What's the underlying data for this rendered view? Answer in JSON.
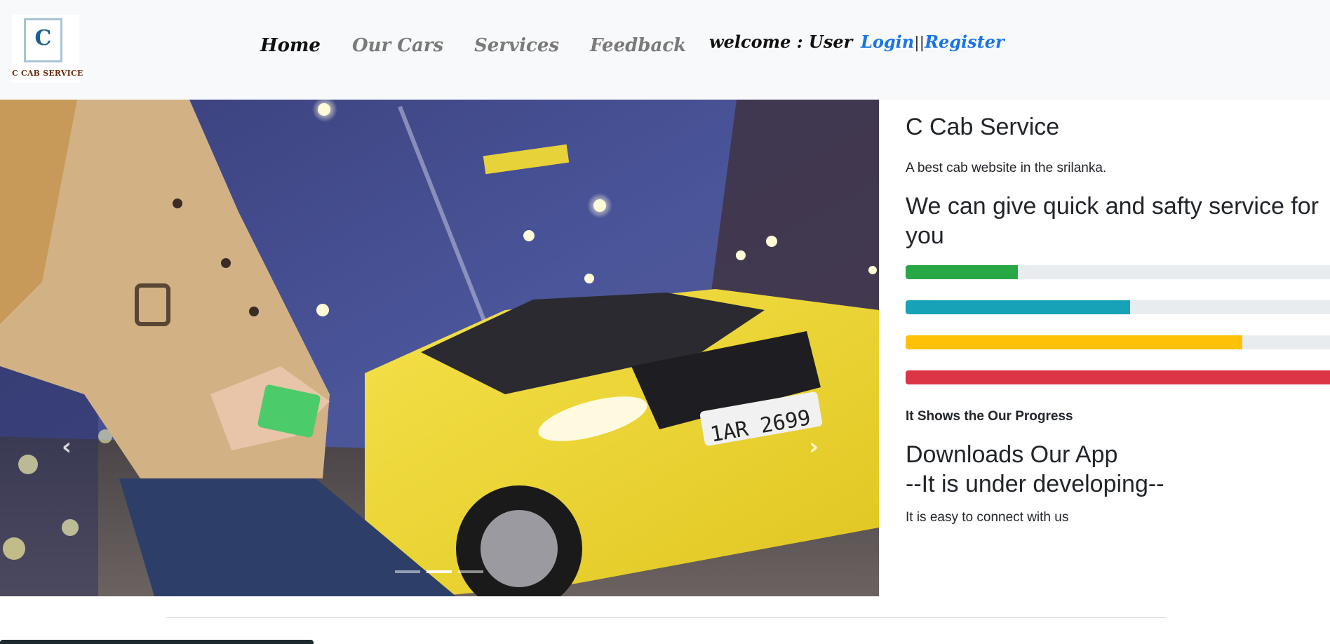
{
  "brand": {
    "logo_letter": "C",
    "logo_text": "C CAB SERVICE"
  },
  "nav": {
    "items": [
      {
        "label": "Home",
        "active": true
      },
      {
        "label": "Our Cars",
        "active": false
      },
      {
        "label": "Services",
        "active": false
      },
      {
        "label": "Feedback",
        "active": false
      }
    ],
    "welcome": "welcome : User",
    "login": "Login",
    "separator": "||",
    "register": "Register"
  },
  "carousel": {
    "prev_icon": "chevron-left-icon",
    "next_icon": "chevron-right-icon",
    "slides": 3,
    "active_slide": 2
  },
  "panel": {
    "title": "C Cab Service",
    "subtitle": "A best cab website in the srilanka.",
    "headline": "We can give quick and safty service for you",
    "progress": [
      {
        "percent": 25,
        "color": "#28a745"
      },
      {
        "percent": 50,
        "color": "#17a2b8"
      },
      {
        "percent": 75,
        "color": "#ffc107"
      },
      {
        "percent": 100,
        "color": "#dc3545"
      }
    ],
    "progress_caption": "It Shows the Our Progress",
    "download_title": "Downloads Our App",
    "download_note": "--It is under developing--",
    "connect_text": "It is easy to connect with us"
  }
}
